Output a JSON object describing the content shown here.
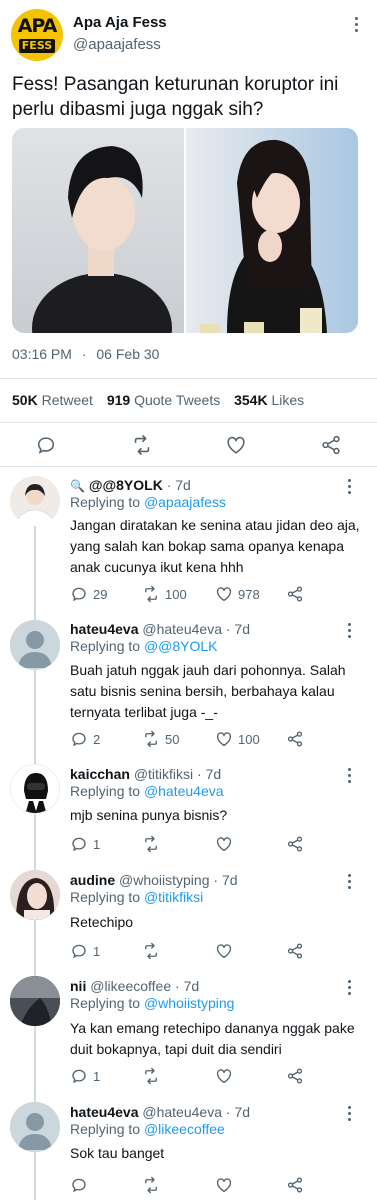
{
  "tweet": {
    "author": {
      "name": "Apa Aja Fess",
      "handle": "@apaajafess",
      "logo_top": "APA",
      "logo_bottom": "FESS"
    },
    "text": "Fess! Pasangan keturunan koruptor ini perlu dibasmi juga nggak sih?",
    "time": "03:16 PM",
    "separator": "·",
    "date": "06 Feb 30",
    "stats": {
      "retweets": "50K",
      "retweets_label": "Retweet",
      "quotes": "919",
      "quotes_label": "Quote Tweets",
      "likes": "354K",
      "likes_label": "Likes"
    }
  },
  "replies": [
    {
      "name": "@@8YOLK",
      "handle": "",
      "time": "· 7d",
      "replying_label": "Replying to",
      "replying_to": "@apaajafess",
      "text": "Jangan diratakan ke senina atau jidan deo aja, yang salah kan bokap sama opanya kenapa anak cucunya ikut kena hhh",
      "replies": "29",
      "retweets": "100",
      "likes": "978"
    },
    {
      "name": "hateu4eva",
      "handle": "@hateu4eva",
      "time": "· 7d",
      "replying_label": "Replying to",
      "replying_to": "@@8YOLK",
      "text": "Buah jatuh nggak jauh dari pohonnya. Salah satu bisnis senina bersih, berbahaya kalau ternyata terlibat juga -_-",
      "replies": "2",
      "retweets": "50",
      "likes": "100"
    },
    {
      "name": "kaicchan",
      "handle": "@titikfiksi",
      "time": "· 7d",
      "replying_label": "Replying to",
      "replying_to": "@hateu4eva",
      "text": "mjb senina punya bisnis?",
      "replies": "1",
      "retweets": "",
      "likes": ""
    },
    {
      "name": "audine",
      "handle": "@whoiistyping",
      "time": "· 7d",
      "replying_label": "Replying to",
      "replying_to": "@titikfiksi",
      "text": "Retechipo",
      "replies": "1",
      "retweets": "",
      "likes": ""
    },
    {
      "name": "nii",
      "handle": "@likeecoffee",
      "time": "· 7d",
      "replying_label": "Replying to",
      "replying_to": "@whoiistyping",
      "text": "Ya kan emang retechipo dananya nggak pake duit bokapnya, tapi duit dia sendiri",
      "replies": "1",
      "retweets": "",
      "likes": ""
    },
    {
      "name": "hateu4eva",
      "handle": "@hateu4eva",
      "time": "· 7d",
      "replying_label": "Replying to",
      "replying_to": "@likeecoffee",
      "text": "Sok tau banget",
      "replies": "",
      "retweets": "",
      "likes": ""
    }
  ],
  "colors": {
    "accent": "#1d9bf0",
    "secondary_text": "#536471",
    "primary_text": "#0f1419",
    "logo_yellow": "#f5c400"
  },
  "icons": [
    "more-icon",
    "reply-icon",
    "retweet-icon",
    "like-icon",
    "share-icon"
  ]
}
